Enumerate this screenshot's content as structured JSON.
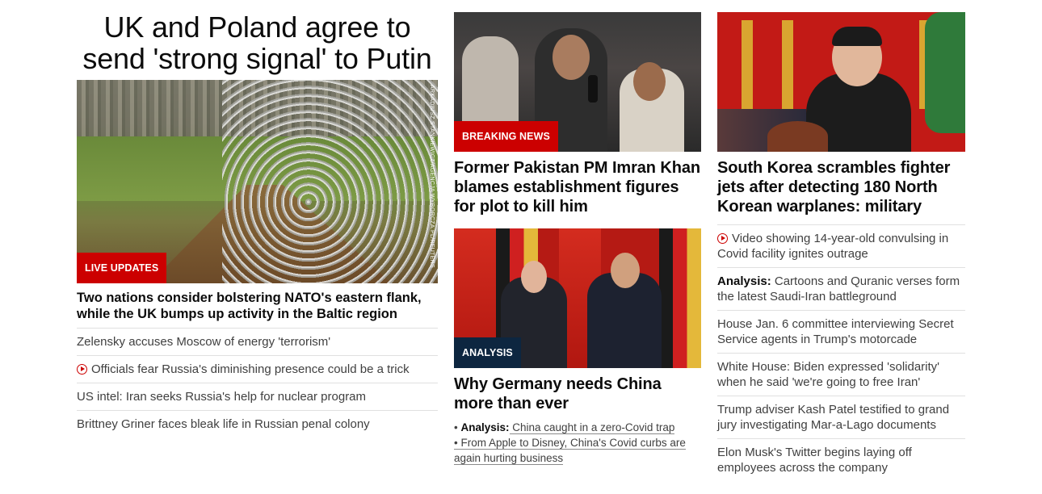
{
  "col1": {
    "title": "UK and Poland agree to send 'strong signal' to Putin",
    "image_credit": "ARKADIUSZ STANKIEWICZ/AGENCJA WYBORCZA.PL/REUTERS",
    "badge": "LIVE UPDATES",
    "lead": "Two nations consider bolstering NATO's eastern flank, while the UK bumps up activity in the Baltic region",
    "links": [
      {
        "text": "Zelensky accuses Moscow of energy 'terrorism'",
        "video": false
      },
      {
        "text": "Officials fear Russia's diminishing presence could be a trick",
        "video": true
      },
      {
        "text": "US intel: Iran seeks Russia's help for nuclear program",
        "video": false
      },
      {
        "text": "Brittney Griner faces bleak life in Russian penal colony",
        "video": false
      }
    ]
  },
  "col2": {
    "story1": {
      "badge": "BREAKING NEWS",
      "headline": "Former Pakistan PM Imran Khan blames establishment figures for plot to kill him"
    },
    "story2": {
      "badge": "ANALYSIS",
      "headline": "Why Germany needs China more than ever",
      "bullets": [
        {
          "prefix": "• ",
          "label": "Analysis:",
          "text": " China caught in a zero-Covid trap"
        },
        {
          "prefix": "• ",
          "label": "",
          "text": "From Apple to Disney, China's Covid curbs are again hurting business"
        }
      ]
    }
  },
  "col3": {
    "headline": "South Korea scrambles fighter jets after detecting 180 North Korean warplanes: military",
    "links": [
      {
        "label": "",
        "text": "Video showing 14-year-old convulsing in Covid facility ignites outrage",
        "video": true
      },
      {
        "label": "Analysis:",
        "text": " Cartoons and Quranic verses form the latest Saudi-Iran battleground",
        "video": false
      },
      {
        "label": "",
        "text": "House Jan. 6 committee interviewing Secret Service agents in Trump's motorcade",
        "video": false
      },
      {
        "label": "",
        "text": "White House: Biden expressed 'solidarity' when he said 'we're going to free Iran'",
        "video": false
      },
      {
        "label": "",
        "text": "Trump adviser Kash Patel testified to grand jury investigating Mar-a-Lago documents",
        "video": false
      },
      {
        "label": "",
        "text": "Elon Musk's Twitter begins laying off employees across the company",
        "video": false
      }
    ]
  },
  "colors": {
    "badge_red": "#cc0000",
    "badge_dark": "#0d2640",
    "text": "#0c0c0c",
    "muted": "#404040"
  }
}
